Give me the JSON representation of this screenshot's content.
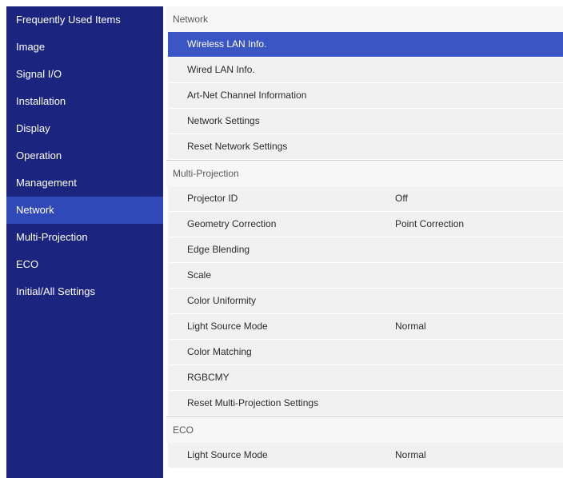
{
  "sidebar": {
    "items": [
      {
        "label": "Frequently Used Items"
      },
      {
        "label": "Image"
      },
      {
        "label": "Signal I/O"
      },
      {
        "label": "Installation"
      },
      {
        "label": "Display"
      },
      {
        "label": "Operation"
      },
      {
        "label": "Management"
      },
      {
        "label": "Network"
      },
      {
        "label": "Multi-Projection"
      },
      {
        "label": "ECO"
      },
      {
        "label": "Initial/All Settings"
      }
    ],
    "active": "Network"
  },
  "network": {
    "header": "Network",
    "rows": [
      {
        "label": "Wireless LAN Info."
      },
      {
        "label": "Wired LAN Info."
      },
      {
        "label": "Art-Net Channel Information"
      },
      {
        "label": "Network Settings"
      },
      {
        "label": "Reset Network Settings"
      }
    ]
  },
  "multi_projection": {
    "header": "Multi-Projection",
    "rows": [
      {
        "label": "Projector ID",
        "value": "Off"
      },
      {
        "label": "Geometry Correction",
        "value": "Point Correction"
      },
      {
        "label": "Edge Blending"
      },
      {
        "label": "Scale"
      },
      {
        "label": "Color Uniformity"
      },
      {
        "label": "Light Source Mode",
        "value": "Normal"
      },
      {
        "label": "Color Matching"
      },
      {
        "label": "RGBCMY"
      },
      {
        "label": "Reset Multi-Projection Settings"
      }
    ]
  },
  "eco": {
    "header": "ECO",
    "rows": [
      {
        "label": "Light Source Mode",
        "value": "Normal"
      }
    ]
  },
  "colors": {
    "sidebar_bg": "#1b2580",
    "sidebar_active": "#2f49b8",
    "row_selected": "#3a55c4",
    "row_bg": "#f1f1f1"
  }
}
